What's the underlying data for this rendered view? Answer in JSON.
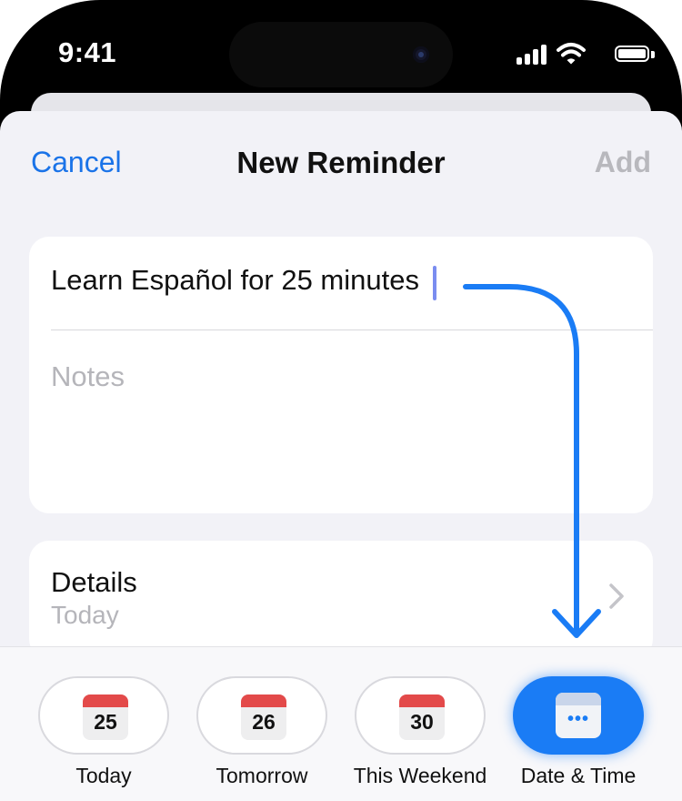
{
  "status_bar": {
    "time": "9:41",
    "icons": [
      "cellular-signal-icon",
      "wifi-icon",
      "battery-icon"
    ]
  },
  "nav": {
    "cancel_label": "Cancel",
    "title": "New Reminder",
    "add_label": "Add"
  },
  "reminder": {
    "title_value": "Learn Español for 25 minutes",
    "notes_placeholder": "Notes"
  },
  "details": {
    "label": "Details",
    "value": "Today"
  },
  "quick_dates": [
    {
      "label": "Today",
      "day": "25"
    },
    {
      "label": "Tomorrow",
      "day": "26"
    },
    {
      "label": "This Weekend",
      "day": "30"
    },
    {
      "label": "Date & Time",
      "icon": "calendar-more-icon",
      "glyph": "•••"
    }
  ],
  "colors": {
    "accent": "#1a7cf5",
    "calendar_red": "#e34a4a",
    "sheet_background": "#f2f2f7",
    "disabled_text": "#b8b8bd"
  }
}
